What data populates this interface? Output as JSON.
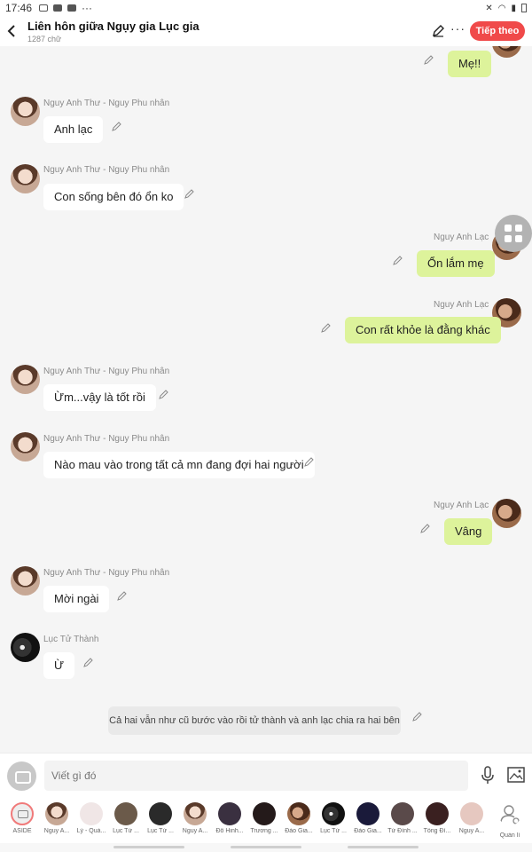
{
  "status": {
    "time": "17:46",
    "dots": "···"
  },
  "header": {
    "title": "Liên hôn giữa Ngụy gia Lục gia",
    "subtitle": "1287 chữ",
    "more": "···",
    "next_label": "Tiếp theo"
  },
  "messages": [
    {
      "side": "out",
      "text": "Mẹ!!"
    },
    {
      "side": "in",
      "speaker": "Nguy Anh Thư - Nguy Phu nhân",
      "text": "Anh lạc"
    },
    {
      "side": "in",
      "speaker": "Nguy Anh Thư - Nguy Phu nhân",
      "text": "Con sống bên đó ổn ko"
    },
    {
      "side": "out",
      "speaker": "Nguy Anh Lạc",
      "text": "Ổn lắm mẹ"
    },
    {
      "side": "out",
      "speaker": "Nguy Anh Lạc",
      "text": "Con rất khỏe là đằng khác"
    },
    {
      "side": "in",
      "speaker": "Nguy Anh Thư - Nguy Phu nhân",
      "text": "Ừm...vậy là tốt rồi"
    },
    {
      "side": "in",
      "speaker": "Nguy Anh Thư - Nguy Phu nhân",
      "text": "Nào mau vào trong tất cả mn đang đợi hai người"
    },
    {
      "side": "out",
      "speaker": "Nguy Anh Lạc",
      "text": "Vâng"
    },
    {
      "side": "in",
      "speaker": "Nguy Anh Thư - Nguy Phu nhân",
      "text": "Mời ngài"
    },
    {
      "side": "in",
      "speaker": "Lục Tử Thành",
      "text": "Ừ"
    }
  ],
  "narration": "Cả hai vẫn như cũ bước vào rồi tử thành và anh lạc chia ra hai bên",
  "input": {
    "placeholder": "Viết gì đó"
  },
  "characters": [
    "ASIDE",
    "Nguy A...",
    "Lý - Quả...",
    "Lục Tử ...",
    "Lục Tử ...",
    "Nguy A...",
    "Đỗ Hinh...",
    "Trương ...",
    "Đào Gia...",
    "Lục Tử ...",
    "Đào Gia...",
    "Tử Đình ...",
    "Tống Đì...",
    "Nguy A...",
    "Quản lí"
  ],
  "colors": {
    "accent": "#f04a4a",
    "outgoing_bubble": "#ddf39b",
    "incoming_bubble": "#ffffff"
  }
}
